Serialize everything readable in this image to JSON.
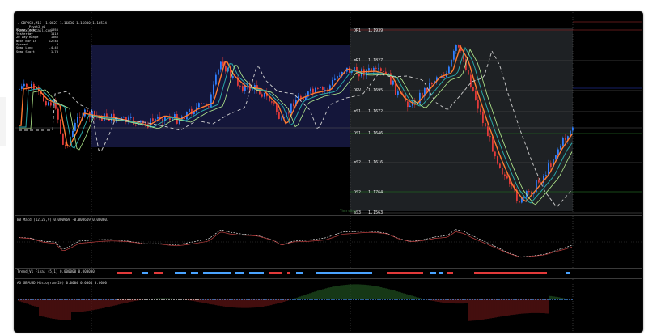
{
  "main": {
    "header": "▾ GBPUSD,M15  1.0827 1.16830 1.16800 1.16534",
    "site": "ForexCocktail.com",
    "day_label": "Thursday"
  },
  "info": {
    "title": "Pivot2_v1",
    "rows": [
      {
        "k": "Range  Today",
        "v": "1955"
      },
      {
        "k": "Yesterday",
        "v": "1119"
      },
      {
        "k": "20 Day Range",
        "v": "1986"
      },
      {
        "k": "Next Bar In",
        "v": "12:48"
      },
      {
        "k": "Spread",
        "v": "0"
      },
      {
        "k": "Swap  Long",
        "v": "-4.46"
      },
      {
        "k": "Swap  Short",
        "v": "1.70"
      }
    ]
  },
  "levels": [
    "DR1   1.1939",
    "mR1   1.1827",
    "DPV   1.1695",
    "mS1   1.1672",
    "DS1   1.1646",
    "mS2   1.1616",
    "DS2   1.1764",
    "mS3   1.1563"
  ],
  "macd": {
    "header": "BB Macd (12,26,9) 0.000969 -0.000619 0.000607"
  },
  "trend": {
    "header": "Trend_V1 Final (5,1) 0.000000 0.000000"
  },
  "hist": {
    "header": "AO GBPUSD Histogram(20) 0.0004 0.0004 0.0000"
  },
  "colors": {
    "bull": "#2f7fff",
    "bear": "#e23a3a",
    "ema_fast": "#ff7a30",
    "ema_mid": "#2aa8a8",
    "ema_slow": "#b6f090",
    "ema_dash": "#cfcfcf",
    "range_box": "#14163a",
    "session_box": "#1e2124",
    "level_red": "#7a2020",
    "level_green": "#1f5f1f",
    "level_blue": "#1e2a8a",
    "hist_pos": "#3fa040",
    "hist_neg": "#c02a2a",
    "dots": "#4aa3ff"
  }
}
